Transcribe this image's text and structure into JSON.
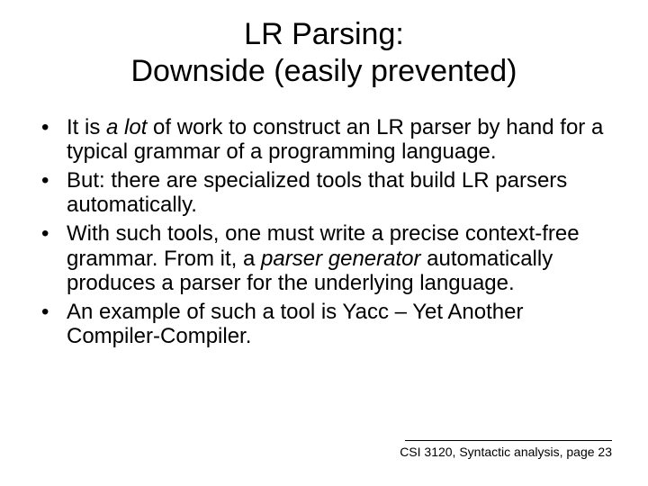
{
  "title": {
    "line1": "LR Parsing:",
    "line2": "Downside (easily prevented)"
  },
  "bullets": {
    "b1a": "It is ",
    "b1b": "a lot",
    "b1c": " of work to construct an LR parser by hand for a typical grammar of a programming language.",
    "b2": "But: there are specialized tools that build LR parsers automatically.",
    "b3a": "With such tools, one must write a precise context-free grammar. From it, a ",
    "b3b": "parser generator",
    "b3c": " automatically produces a parser for the underlying language.",
    "b4": "An example of such a tool is Yacc – Yet Another Compiler-Compiler."
  },
  "footer": "CSI 3120, Syntactic analysis, page 23"
}
